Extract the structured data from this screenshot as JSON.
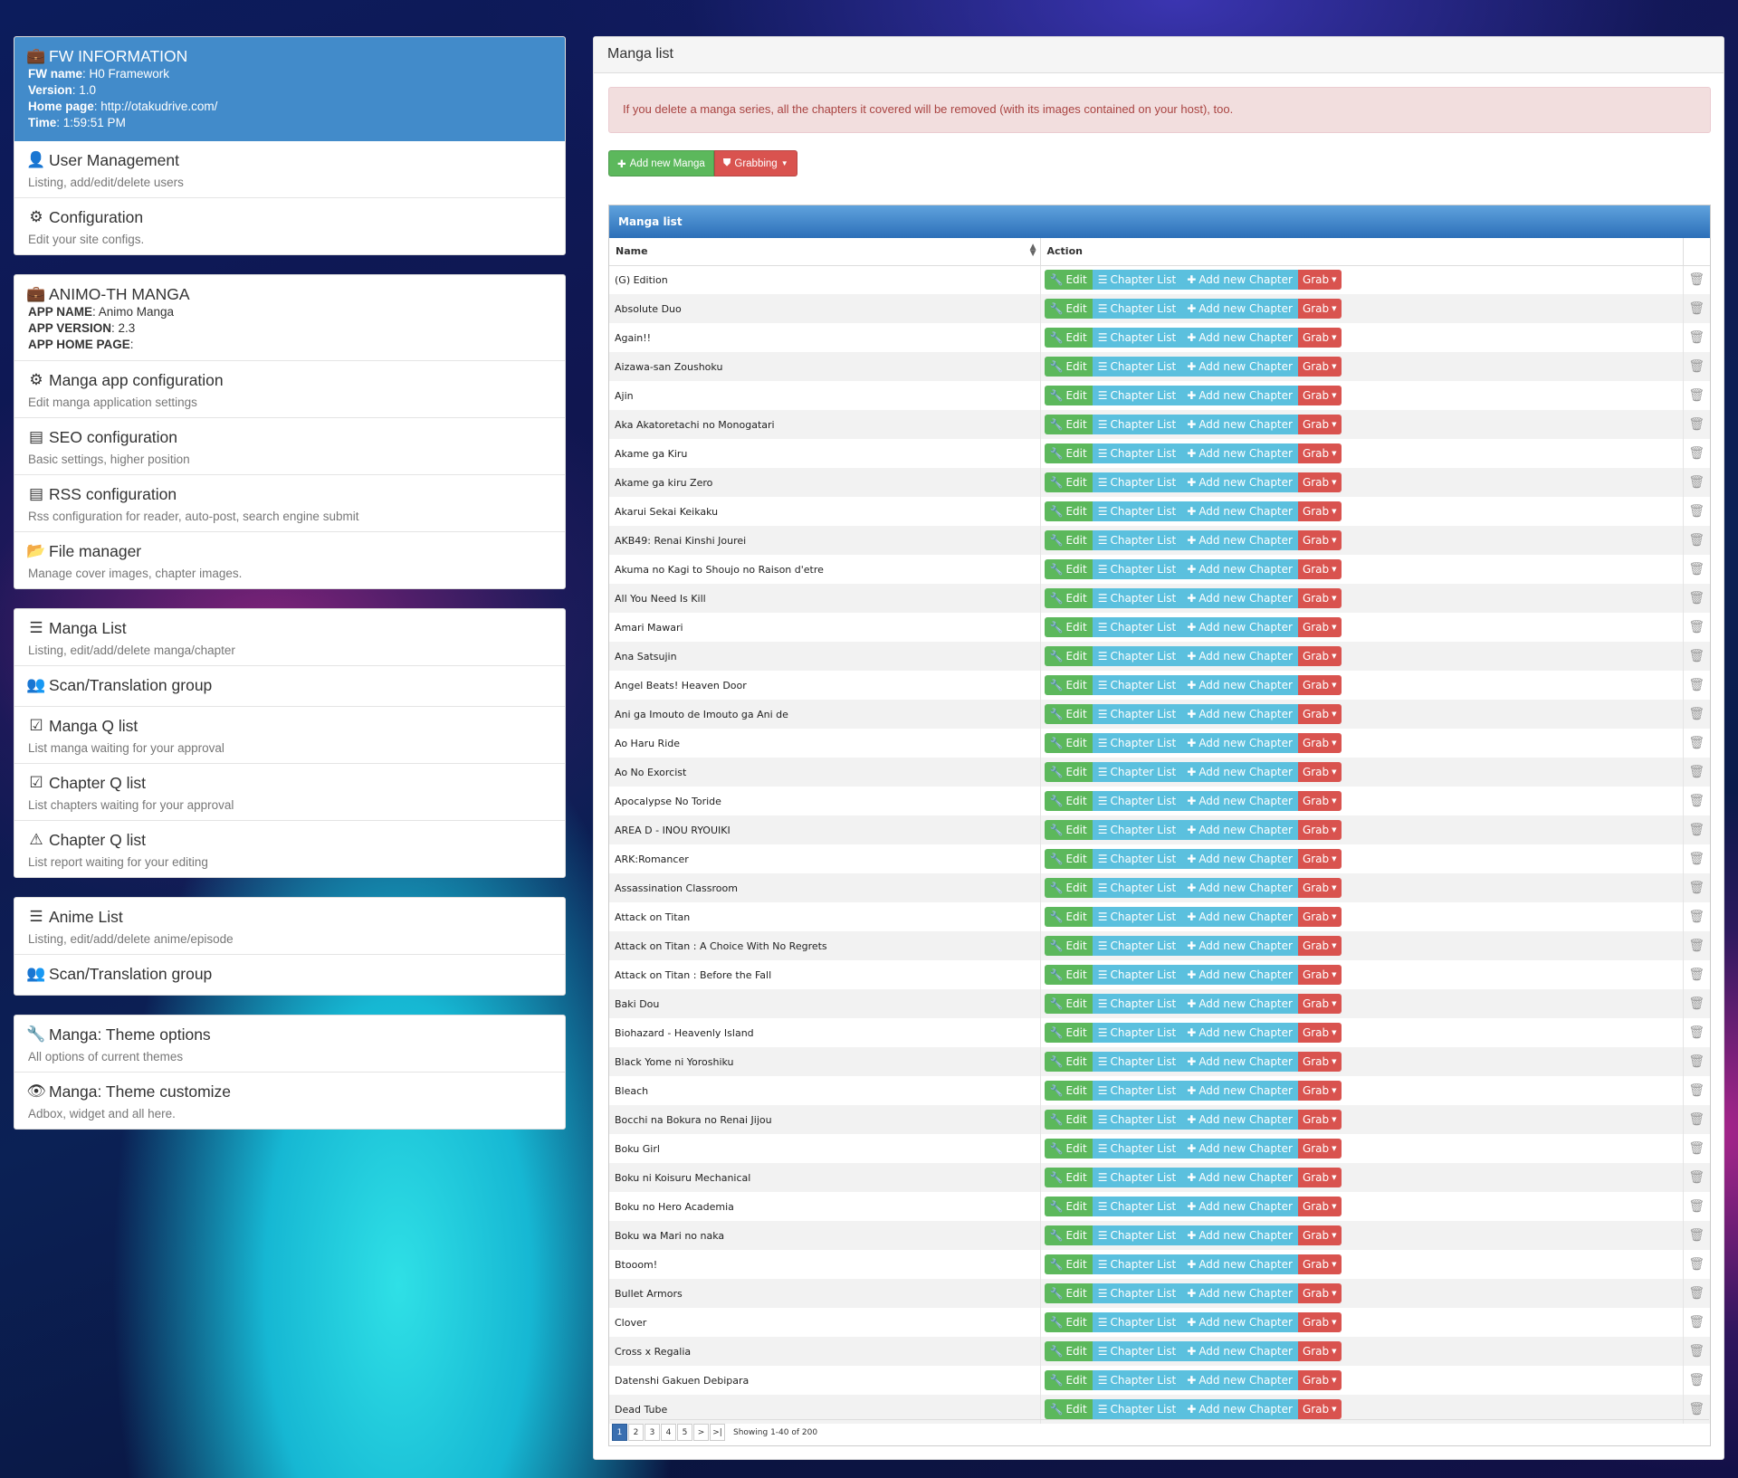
{
  "fw_info": {
    "title": "FW INFORMATION",
    "rows": [
      {
        "key": "FW name",
        "value": ": H0 Framework"
      },
      {
        "key": "Version",
        "value": ": 1.0"
      },
      {
        "key": "Home page",
        "value": ": http://otakudrive.com/"
      },
      {
        "key": "Time",
        "value": ": 1:59:51 PM"
      }
    ]
  },
  "panel1": [
    {
      "title": "User Management",
      "desc": "Listing, add/edit/delete users",
      "icon": "user-icon"
    },
    {
      "title": "Configuration",
      "desc": "Edit your site configs.",
      "icon": "gear-icon"
    }
  ],
  "app_info": {
    "title": "ANIMO-TH MANGA",
    "rows": [
      {
        "key": "APP NAME",
        "value": ": Animo Manga"
      },
      {
        "key": "APP VERSION",
        "value": ": 2.3"
      },
      {
        "key": "APP HOME PAGE",
        "value": ":"
      }
    ]
  },
  "panel2": [
    {
      "title": "Manga app configuration",
      "desc": "Edit manga application settings",
      "icon": "gear-icon"
    },
    {
      "title": "SEO configuration",
      "desc": "Basic settings, higher position",
      "icon": "list-alt-icon"
    },
    {
      "title": "RSS configuration",
      "desc": "Rss configuration for reader, auto-post, search engine submit",
      "icon": "list-alt-icon"
    },
    {
      "title": "File manager",
      "desc": "Manage cover images, chapter images.",
      "icon": "folder-open-icon"
    }
  ],
  "panel3": [
    {
      "title": "Manga List",
      "desc": "Listing, edit/add/delete manga/chapter",
      "icon": "list-icon"
    },
    {
      "title": "Scan/Translation group",
      "desc": "",
      "icon": "users-icon"
    },
    {
      "title": "Manga Q list",
      "desc": "List manga waiting for your approval",
      "icon": "check-icon"
    },
    {
      "title": "Chapter Q list",
      "desc": "List chapters waiting for your approval",
      "icon": "check-icon"
    },
    {
      "title": "Chapter Q list",
      "desc": "List report waiting for your editing",
      "icon": "warning-icon"
    }
  ],
  "panel4": [
    {
      "title": "Anime List",
      "desc": "Listing, edit/add/delete anime/episode",
      "icon": "list-icon"
    },
    {
      "title": "Scan/Translation group",
      "desc": "",
      "icon": "users-icon"
    }
  ],
  "panel5": [
    {
      "title": "Manga: Theme options",
      "desc": "All options of current themes",
      "icon": "wrench-icon"
    },
    {
      "title": "Manga: Theme customize",
      "desc": "Adbox, widget and all here.",
      "icon": "eye-icon"
    }
  ],
  "main": {
    "title": "Manga list",
    "alert": "If you delete a manga series, all the chapters it covered will be removed (with its images contained on your host), too.",
    "add_button": "Add new Manga",
    "grab_button": "Grabbing",
    "grid_title": "Manga list",
    "col_name": "Name",
    "col_action": "Action",
    "action_labels": {
      "edit": "Edit",
      "chapter_list": "Chapter List",
      "add_chapter": "Add new Chapter",
      "grab": "Grab"
    },
    "rows": [
      "(G) Edition",
      "Absolute Duo",
      "Again!!",
      "Aizawa-san Zoushoku",
      "Ajin",
      "Aka Akatoretachi no Monogatari",
      "Akame ga Kiru",
      "Akame ga kiru Zero",
      "Akarui Sekai Keikaku",
      "AKB49: Renai Kinshi Jourei",
      "Akuma no Kagi to Shoujo no Raison d'etre",
      "All You Need Is Kill",
      "Amari Mawari",
      "Ana Satsujin",
      "Angel Beats! Heaven Door",
      "Ani ga Imouto de Imouto ga Ani de",
      "Ao Haru Ride",
      "Ao No Exorcist",
      "Apocalypse No Toride",
      "AREA D - INOU RYOUIKI",
      "ARK:Romancer",
      "Assassination Classroom",
      "Attack on Titan",
      "Attack on Titan : A Choice With No Regrets",
      "Attack on Titan : Before the Fall",
      "Baki Dou",
      "Biohazard - Heavenly Island",
      "Black Yome ni Yoroshiku",
      "Bleach",
      "Bocchi na Bokura no Renai Jijou",
      "Boku Girl",
      "Boku ni Koisuru Mechanical",
      "Boku no Hero Academia",
      "Boku wa Mari no naka",
      "Btooom!",
      "Bullet Armors",
      "Clover",
      "Cross x Regalia",
      "Datenshi Gakuen Debipara",
      "Dead Tube"
    ],
    "pager": {
      "pages": [
        "1",
        "2",
        "3",
        "4",
        "5",
        ">",
        ">|"
      ],
      "active": "1",
      "info": "Showing 1-40 of 200"
    }
  }
}
